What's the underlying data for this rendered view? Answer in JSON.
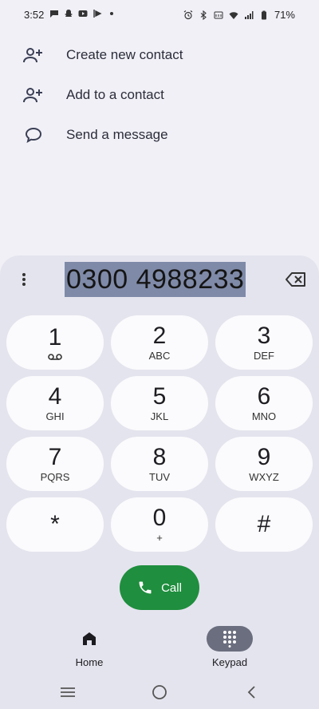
{
  "status_bar": {
    "time": "3:52",
    "battery": "71%",
    "left_icons": [
      "chat-bubble-icon",
      "snapchat-icon",
      "youtube-icon",
      "play-icon",
      "dot-icon"
    ],
    "right_icons": [
      "alarm-icon",
      "bluetooth-icon",
      "volte-icon",
      "wifi-icon",
      "signal-icon",
      "battery-icon"
    ]
  },
  "actions": [
    {
      "label": "Create new contact",
      "icon": "add-person-icon"
    },
    {
      "label": "Add to a contact",
      "icon": "add-person-icon"
    },
    {
      "label": "Send a message",
      "icon": "message-icon"
    }
  ],
  "dialer": {
    "number": "0300 4988233",
    "more_icon": "more-vert-icon",
    "backspace_icon": "backspace-icon"
  },
  "keypad": [
    {
      "digit": "1",
      "letters": ""
    },
    {
      "digit": "2",
      "letters": "ABC"
    },
    {
      "digit": "3",
      "letters": "DEF"
    },
    {
      "digit": "4",
      "letters": "GHI"
    },
    {
      "digit": "5",
      "letters": "JKL"
    },
    {
      "digit": "6",
      "letters": "MNO"
    },
    {
      "digit": "7",
      "letters": "PQRS"
    },
    {
      "digit": "8",
      "letters": "TUV"
    },
    {
      "digit": "9",
      "letters": "WXYZ"
    },
    {
      "digit": "*",
      "letters": ""
    },
    {
      "digit": "0",
      "letters": "+"
    },
    {
      "digit": "#",
      "letters": ""
    }
  ],
  "call_button": {
    "label": "Call",
    "color": "#1f8e3e"
  },
  "bottom_nav": {
    "home_label": "Home",
    "keypad_label": "Keypad",
    "active": "Keypad"
  },
  "system_nav": [
    "recents-icon",
    "home-circle-icon",
    "back-chevron-icon"
  ]
}
